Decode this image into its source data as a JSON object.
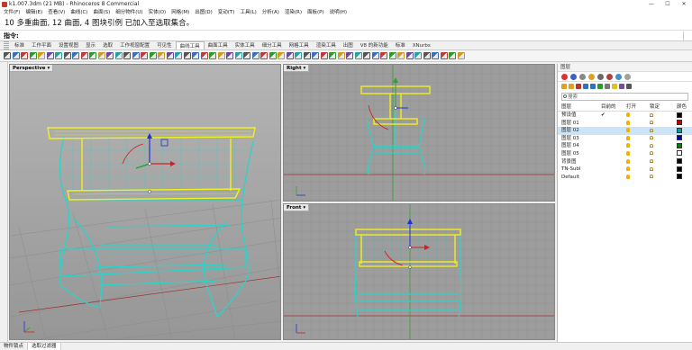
{
  "window": {
    "title": "k1.007.3dm (21 MB) - Rhinoceros 8 Commercial",
    "controls": [
      "—",
      "☐",
      "✕"
    ]
  },
  "menu": [
    "文件(F)",
    "编辑(E)",
    "查看(V)",
    "曲线(C)",
    "曲面(S)",
    "细分物件(U)",
    "实体(O)",
    "网格(M)",
    "出图(D)",
    "变动(T)",
    "工具(L)",
    "分析(A)",
    "渲染(R)",
    "面板(P)",
    "说明(H)"
  ],
  "command_history": "10 多重曲面, 12 曲面, 4 图块引例 已加入至选取集合。",
  "command_prompt": "指令:",
  "toolbar_tabs": [
    "标准",
    "工作平面",
    "设置视图",
    "显示",
    "选取",
    "工作视窗配置",
    "可见性",
    "曲线工具",
    "曲面工具",
    "实体工具",
    "细分工具",
    "网格工具",
    "渲染工具",
    "出图",
    "V8 的新功能",
    "标准",
    "XNurbs"
  ],
  "active_tab_index": 7,
  "toolbar_icons": [
    "line",
    "polyline",
    "curve",
    "circle",
    "arc",
    "rectangle",
    "fillet",
    "offset",
    "extend",
    "trim",
    "split",
    "join",
    "explode",
    "rebuild",
    "project",
    "surface",
    "loft",
    "sweep",
    "extrude",
    "revolve",
    "patch",
    "network",
    "blend",
    "boolean",
    "shell",
    "cap",
    "fillet-edge",
    "mesh",
    "subd",
    "text",
    "dimension",
    "layout",
    "render",
    "camera",
    "light",
    "material",
    "cplane",
    "snap",
    "grid",
    "ortho",
    "planar",
    "osnap",
    "gumball",
    "history",
    "filter",
    "properties",
    "lock",
    "hide",
    "show",
    "select",
    "zoom",
    "pan",
    "rotate",
    "view"
  ],
  "viewports": {
    "perspective": "Perspective",
    "right": "Right",
    "front": "Front",
    "dropdown": "▾"
  },
  "layers_panel": {
    "title": "图层",
    "search_placeholder": "搜索",
    "columns": [
      "图层",
      "目前的",
      "打开",
      "锁定",
      "颜色"
    ],
    "rows": [
      {
        "name": "预设值",
        "current": "✔",
        "color": "#000000",
        "on": true,
        "locked": false
      },
      {
        "name": "图层 01",
        "current": "",
        "color": "#c00000",
        "on": true,
        "locked": false
      },
      {
        "name": "图层 02",
        "current": "",
        "color": "#00a0a0",
        "on": true,
        "locked": false,
        "selected": true
      },
      {
        "name": "图层 03",
        "current": "",
        "color": "#0000c0",
        "on": true,
        "locked": false
      },
      {
        "name": "图层 04",
        "current": "",
        "color": "#008000",
        "on": true,
        "locked": false
      },
      {
        "name": "图层 05",
        "current": "",
        "color": "#ffffff",
        "on": true,
        "locked": false
      },
      {
        "name": "背景图",
        "current": "",
        "color": "#000000",
        "on": true,
        "locked": false
      },
      {
        "name": "TN-Subl",
        "current": "",
        "color": "#000000",
        "on": true,
        "locked": false
      },
      {
        "name": "Default",
        "current": "",
        "color": "#000000",
        "on": true,
        "locked": false
      }
    ]
  },
  "status_tabs": [
    "物件锁点",
    "选取过滤器"
  ],
  "colors": {
    "model_cyan": "#2ad4c8",
    "selected_yellow": "#f0f020",
    "viewport_bg": "#9c9c9c",
    "grid": "#8a8a8a",
    "axis_x": "#c03030",
    "axis_y": "#30a030",
    "selection_blue": "#cce4f7"
  }
}
